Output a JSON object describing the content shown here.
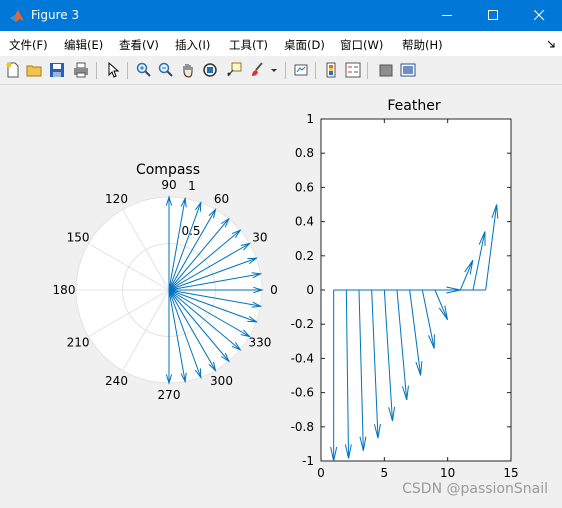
{
  "window": {
    "title": "Figure 3"
  },
  "menubar": {
    "items": [
      "文件(F)",
      "编辑(E)",
      "查看(V)",
      "插入(I)",
      "工具(T)",
      "桌面(D)",
      "窗口(W)",
      "帮助(H)"
    ]
  },
  "toolbar": {
    "icons": [
      "new-file-icon",
      "open-folder-icon",
      "save-icon",
      "print-icon",
      "pointer-icon",
      "zoom-in-icon",
      "zoom-out-icon",
      "pan-hand-icon",
      "rotate-3d-icon",
      "data-cursor-icon",
      "brush-icon",
      "dropdown-arrow-icon",
      "link-plot-icon",
      "colorbar-icon",
      "legend-icon",
      "hide-plot-tools-icon",
      "show-plot-tools-icon"
    ]
  },
  "compass": {
    "title": "Compass",
    "angle_labels": [
      "0",
      "30",
      "60",
      "90",
      "120",
      "150",
      "180",
      "210",
      "240",
      "270",
      "300",
      "330"
    ],
    "radius_labels": [
      "0.5",
      "1"
    ],
    "vector_angles_deg": [
      0,
      10,
      20,
      30,
      40,
      50,
      60,
      70,
      80,
      90,
      -10,
      -20,
      -30,
      -40,
      -50,
      -60,
      -70,
      -80,
      -90
    ],
    "vector_length": 1
  },
  "feather": {
    "title": "Feather",
    "x_ticks": [
      "0",
      "5",
      "10",
      "15"
    ],
    "y_ticks": [
      "-1",
      "-0.8",
      "-0.6",
      "-0.4",
      "-0.2",
      "0",
      "0.2",
      "0.4",
      "0.6",
      "0.8",
      "1"
    ],
    "xlim": [
      0,
      15
    ],
    "ylim": [
      -1,
      1
    ],
    "theta": [
      -90,
      -80,
      -70,
      -60,
      -50,
      -40,
      -30,
      -20,
      -10,
      0,
      10,
      20,
      30
    ],
    "length": 1
  },
  "watermark": "CSDN @passionSnail",
  "colors": {
    "vector": "#0072bd",
    "titlebar": "#0078d7"
  }
}
